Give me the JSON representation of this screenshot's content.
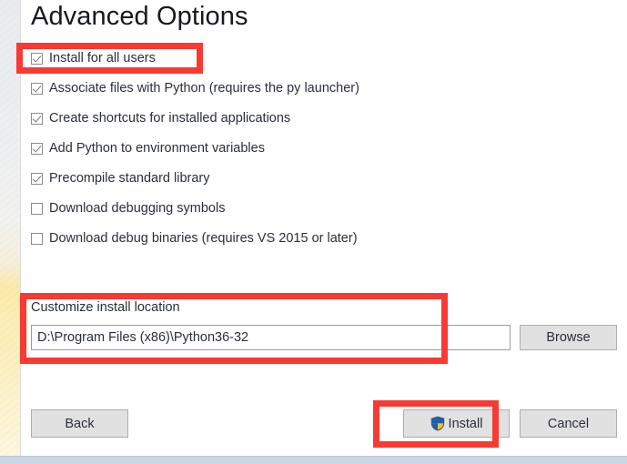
{
  "page": {
    "title": "Advanced Options"
  },
  "options": [
    {
      "label": "Install for all users",
      "checked": true
    },
    {
      "label": "Associate files with Python (requires the py launcher)",
      "checked": true
    },
    {
      "label": "Create shortcuts for installed applications",
      "checked": true
    },
    {
      "label": "Add Python to environment variables",
      "checked": true
    },
    {
      "label": "Precompile standard library",
      "checked": true
    },
    {
      "label": "Download debugging symbols",
      "checked": false
    },
    {
      "label": "Download debug binaries (requires VS 2015 or later)",
      "checked": false
    }
  ],
  "install_location": {
    "label": "Customize install location",
    "path_value": "D:\\Program Files (x86)\\Python36-32",
    "path_placeholder": "",
    "browse_label": "Browse"
  },
  "buttons": {
    "back": "Back",
    "install": "Install",
    "cancel": "Cancel"
  },
  "icons": {
    "uac_shield": "uac-shield-icon",
    "checkbox_checked": "checkbox-checked-icon",
    "checkbox_unchecked": "checkbox-unchecked-icon"
  },
  "annotations": {
    "highlight_color": "#f83a32",
    "boxes": [
      {
        "name": "install-for-all-users",
        "target": "Install for all users"
      },
      {
        "name": "customize-install-location",
        "target": "Customize install location"
      },
      {
        "name": "install-button",
        "target": "Install"
      }
    ]
  },
  "colors": {
    "title_text": "#16191f",
    "body_text": "#2a2f3a",
    "button_face": "#e1e1e1",
    "button_border": "#adadad",
    "input_border": "#9a9a9a",
    "footer_bar": "#ccd7e4",
    "shield_blue": "#1c5fb0",
    "shield_yellow": "#f0c420"
  }
}
